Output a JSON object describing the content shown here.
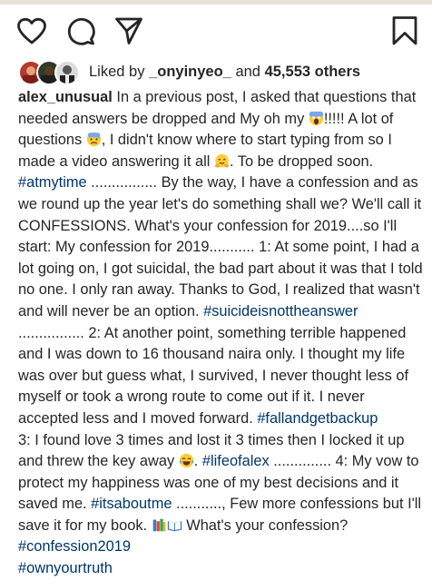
{
  "actions": {
    "like_icon": "heart-outline-icon",
    "comment_icon": "comment-bubble-icon",
    "share_icon": "paper-plane-icon",
    "save_icon": "bookmark-icon"
  },
  "likes": {
    "prefix": "Liked by ",
    "user": "_onyinyeo_",
    "middle": " and ",
    "count": "45,553 others"
  },
  "caption": {
    "username": "alex_unusual",
    "p1": " In a previous post, I asked that questions that needed answers be dropped and My oh my ",
    "p2": "!!!!! A lot of questions ",
    "p3": ", I didn't know where to start typing from so I made a video answering it all ",
    "p4": ". To be dropped soon. ",
    "tag1": "#atmytime",
    "p5": " ................ By the way, I have a confession and as we round up the year let's do something shall we? We'll call it CONFESSIONS. What's your confession for 2019....so I'll start: My confession for 2019........... 1: At some point, I had a lot going on, I got suicidal, the bad part about it was that I told no one. I only ran away. Thanks to God, I realized that wasn't and will never be an option. ",
    "tag2": "#suicideisnottheanswer",
    "p6": " ................ 2: At another point, something terrible happened and I was down to 16 thousand naira only. I thought my life was over but guess what, I survived, I never thought less of myself or took a wrong route to come out if it. I never accepted less and I moved forward. ",
    "tag3": "#fallandgetbackup",
    "p7": "3: I found love 3 times and lost it 3 times then I locked it up and threw the key away ",
    "p8": ". ",
    "tag4": "#lifeofalex",
    "p9": " .............. 4: My vow to protect my happiness was one of my best decisions and it saved me. ",
    "tag5": "#itsaboutme",
    "p10": " ..........., Few more confessions but I'll save it for my book. ",
    "p11": " What's your confession? ",
    "tag6": "#confession2019",
    "tag7": "#ownyourtruth",
    "emoji": [
      "screaming-face-emoji",
      "anxious-sweat-face-emoji",
      "hugging-face-emoji",
      "tears-of-joy-emoji",
      "books-emoji",
      "open-book-emoji"
    ]
  }
}
